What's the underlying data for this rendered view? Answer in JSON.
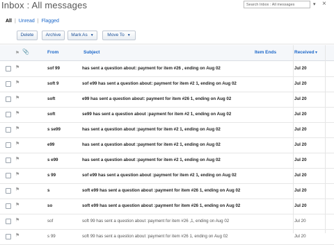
{
  "header": {
    "title": "Inbox : All messages",
    "search_placeholder": "Search Inbox : All messages",
    "search_caret": "▾",
    "close_glyph": "×"
  },
  "filters": {
    "all": "All",
    "unread": "Unread",
    "flagged": "Flagged",
    "separator": "|"
  },
  "toolbar": {
    "delete": "Delete",
    "archive": "Archive",
    "mark_as": "Mark As",
    "move_to": "Move To",
    "caret": "▼"
  },
  "columns": {
    "flag_icon": "⚑",
    "attachment_icon": "📎",
    "from": "From",
    "subject": "Subject",
    "item_ends": "Item Ends",
    "received": "Received",
    "sort_caret": "▼"
  },
  "messages": [
    {
      "from": "sof  99",
      "subject": "has sent a question about: payment for item #26   , ending on Aug 02",
      "received": "Jul 20",
      "read": false
    },
    {
      "from": "soft   9",
      "subject": "sof   e99 has sent a question about: payment for item #2   1, ending on Aug 02",
      "received": "Jul 20",
      "read": false
    },
    {
      "from": "soft",
      "subject": "e99 has sent a question about: payment for item #26   1, ending on Aug 02",
      "received": "Jul 20",
      "read": false
    },
    {
      "from": "soft",
      "subject": "se99 has sent a question about :payment for item #2   1, ending on Aug 02",
      "received": "Jul 20",
      "read": false
    },
    {
      "from": "s   se99",
      "subject": "has sent a question about :payment for item #2   1, ending on Aug 02",
      "received": "Jul 20",
      "read": false
    },
    {
      "from": "e99",
      "subject": "has sent a question about :payment for item #2   1, ending on Aug 02",
      "received": "Jul 20",
      "read": false
    },
    {
      "from": "s   e99",
      "subject": "has sent a question about :payment for item #2   1, ending on Aug 02",
      "received": "Jul 20",
      "read": false
    },
    {
      "from": "s   99",
      "subject": "sof   e99 has sent a question about :payment for item #2   1, ending on Aug 02",
      "received": "Jul 20",
      "read": false
    },
    {
      "from": "s",
      "subject": "soft   e99 has sent a question about :payment for item #26   1, ending on Aug 02",
      "received": "Jul 20",
      "read": false
    },
    {
      "from": "so",
      "subject": "soft   e99 has sent a question about :payment for item #26   1, ending on Aug 02",
      "received": "Jul 20",
      "read": false
    },
    {
      "from": "sof",
      "subject": "soft   99 has sent a question about :payment for item #26   ,1, ending on Aug 02",
      "received": "Jul 20",
      "read": true
    },
    {
      "from": "s   99",
      "subject": "soft   99 has sent a question about :payment for item #26   1, ending on Aug 02",
      "received": "Jul 20",
      "read": true
    }
  ]
}
